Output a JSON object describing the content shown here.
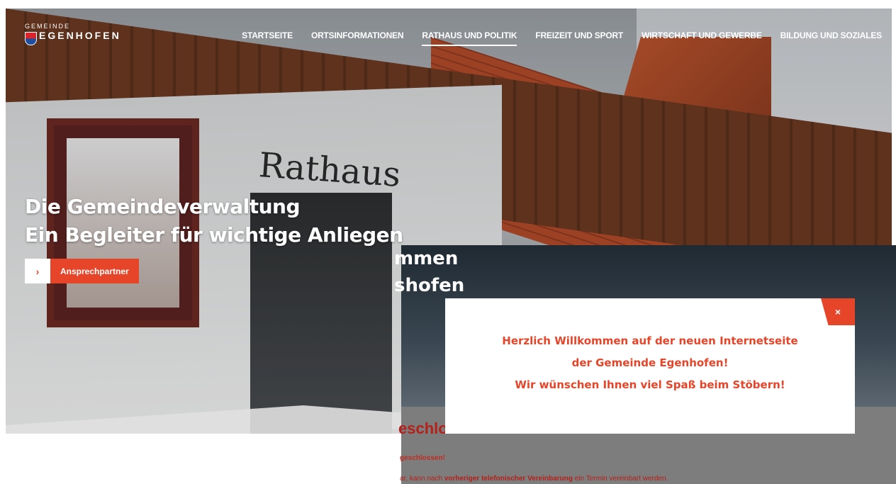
{
  "brand": {
    "small": "GEMEINDE",
    "name": "EGENHOFEN"
  },
  "nav": [
    {
      "label": "STARTSEITE",
      "active": false
    },
    {
      "label": "ORTSINFORMATIONEN",
      "active": false
    },
    {
      "label": "RATHAUS UND POLITIK",
      "active": true
    },
    {
      "label": "FREIZEIT UND SPORT",
      "active": false
    },
    {
      "label": "WIRTSCHAFT UND GEWERBE",
      "active": false
    },
    {
      "label": "BILDUNG UND SOZIALES",
      "active": false
    }
  ],
  "hero": {
    "sign": "Rathaus",
    "line1": "Die Gemeindeverwaltung",
    "line2": "Ein Begleiter für wichtige Anliegen",
    "cta_arrow": "›",
    "cta_label": "Ansprechpartner"
  },
  "background_page": {
    "fragment1": "mmen",
    "fragment2": "shofen",
    "heading": "eschlossen!",
    "line1": "geschlossen!",
    "line2_pre": "ar, kann nach ",
    "line2_bold": "vorheriger telefonischer Vereinbarung",
    "line2_post": " ein Termin vereinbart werden."
  },
  "modal": {
    "close": "×",
    "line1": "Herzlich Willkommen auf der neuen Internetseite",
    "line2": "der Gemeinde Egenhofen!",
    "line3": "Wir wünschen Ihnen viel Spaß beim Stöbern!"
  },
  "colors": {
    "accent": "#e6452a",
    "dark_red": "#b4201a"
  }
}
